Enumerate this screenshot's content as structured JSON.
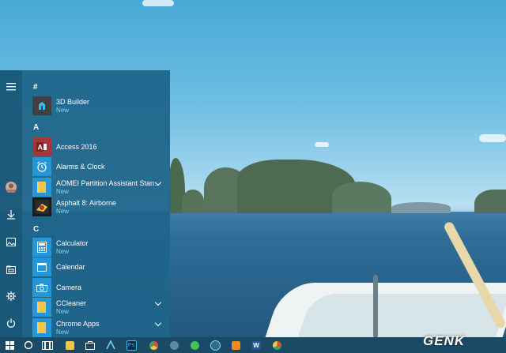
{
  "start_menu": {
    "sections": [
      {
        "header": "#",
        "apps": [
          {
            "name": "3D Builder",
            "badge": "New",
            "icon": "3d-builder-icon",
            "tile_color": "#404040",
            "chevron": false
          }
        ]
      },
      {
        "header": "A",
        "apps": [
          {
            "name": "Access 2016",
            "badge": "",
            "icon": "access-icon",
            "tile_color": "#a4373a",
            "chevron": false
          },
          {
            "name": "Alarms & Clock",
            "badge": "",
            "icon": "alarm-clock-icon",
            "tile_color": "#2596d6",
            "chevron": false
          },
          {
            "name": "AOMEI Partition Assistant Stan...",
            "badge": "New",
            "icon": "folder-icon",
            "tile_color": "#2596d6",
            "chevron": true
          },
          {
            "name": "Asphalt 8: Airborne",
            "badge": "New",
            "icon": "asphalt-game-icon",
            "tile_color": "#1a1a1a",
            "chevron": false
          }
        ]
      },
      {
        "header": "C",
        "apps": [
          {
            "name": "Calculator",
            "badge": "New",
            "icon": "calculator-icon",
            "tile_color": "#2596d6",
            "chevron": false
          },
          {
            "name": "Calendar",
            "badge": "",
            "icon": "calendar-icon",
            "tile_color": "#2596d6",
            "chevron": false
          },
          {
            "name": "Camera",
            "badge": "",
            "icon": "camera-icon",
            "tile_color": "#2596d6",
            "chevron": false
          },
          {
            "name": "CCleaner",
            "badge": "New",
            "icon": "folder-icon",
            "tile_color": "#2596d6",
            "chevron": true
          },
          {
            "name": "Chrome Apps",
            "badge": "New",
            "icon": "folder-icon",
            "tile_color": "#2596d6",
            "chevron": true
          }
        ]
      }
    ],
    "left_rail": [
      "hamburger-menu-icon",
      "user-avatar",
      "downloads-icon",
      "pictures-icon",
      "file-explorer-icon",
      "settings-gear-icon",
      "power-icon"
    ]
  },
  "taskbar": {
    "items": [
      "start-button",
      "cortana-search-icon",
      "task-view-icon",
      "file-explorer-icon",
      "store-icon",
      "app-icon",
      "photoshop-icon",
      "chrome-like-icon",
      "whatsapp-icon",
      "app-icon",
      "media-player-icon",
      "word-icon",
      "chrome-icon"
    ]
  },
  "watermark": "GENK",
  "colors": {
    "start_bg": "#1f658a",
    "accent": "#2596d6",
    "new_badge": "#7fd3f5",
    "taskbar": "#1a4a66"
  }
}
